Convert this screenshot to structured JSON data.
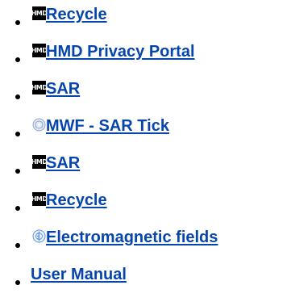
{
  "links": [
    {
      "label": " Recycle",
      "icon": "hmd-logo-icon",
      "icon_text": "HMD"
    },
    {
      "label": " HMD Privacy Portal",
      "icon": "hmd-logo-icon",
      "icon_text": "HMD"
    },
    {
      "label": " SAR",
      "icon": "hmd-logo-icon",
      "icon_text": "HMD"
    },
    {
      "label": " MWF - SAR Tick",
      "icon": "globe-icon"
    },
    {
      "label": " SAR",
      "icon": "hmd-logo-icon",
      "icon_text": "HMD"
    },
    {
      "label": " Recycle",
      "icon": "hmd-logo-icon",
      "icon_text": "HMD"
    },
    {
      "label": " Electromagnetic fields",
      "icon": "who-emblem-icon"
    },
    {
      "label": "User Manual",
      "icon": null
    }
  ],
  "colors": {
    "link": "#0645ad",
    "bullet": "#000000",
    "hmd_icon_bg": "#000000",
    "globe_icon": "#8fa9d0",
    "who_icon": "#5b92e5"
  }
}
